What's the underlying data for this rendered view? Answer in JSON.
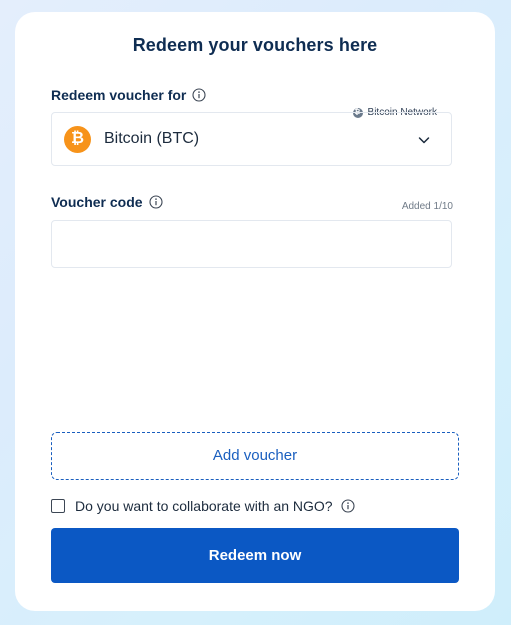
{
  "card": {
    "title": "Redeem your vouchers here"
  },
  "redeem_for": {
    "label": "Redeem voucher for",
    "info_icon": "info-icon",
    "network_label": "Bitcoin Network",
    "network_icon": "bitcoin-network-icon",
    "selected_value": "Bitcoin (BTC)",
    "coin_icon": "bitcoin-icon",
    "coin_symbol": "₿",
    "coin_color": "#f7931a",
    "dropdown_icon": "chevron-down-icon"
  },
  "voucher_code": {
    "label": "Voucher code",
    "info_icon": "info-icon",
    "added_count": "Added 1/10",
    "value": "",
    "placeholder": ""
  },
  "add_voucher": {
    "label": "Add voucher"
  },
  "ngo": {
    "label": "Do you want to collaborate with an NGO?",
    "checked": false,
    "info_icon": "info-icon"
  },
  "redeem_button": {
    "label": "Redeem now",
    "color": "#0b58c4"
  },
  "colors": {
    "accent": "#1a5fbf",
    "text_dark": "#0f2d52"
  }
}
